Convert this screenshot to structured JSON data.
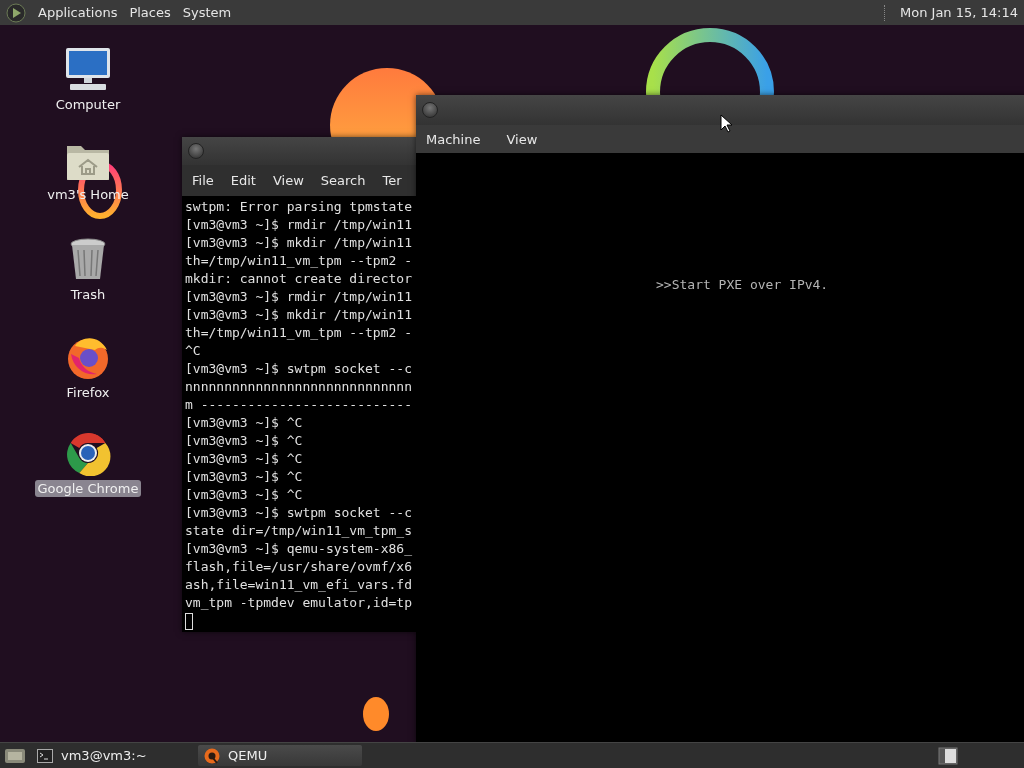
{
  "top_panel": {
    "menus": [
      "Applications",
      "Places",
      "System"
    ],
    "clock": "Mon Jan 15, 14:14"
  },
  "desktop_icons": [
    {
      "label": "Computer",
      "kind": "computer",
      "selected": false
    },
    {
      "label": "vm3's Home",
      "kind": "home",
      "selected": false
    },
    {
      "label": "Trash",
      "kind": "trash",
      "selected": false
    },
    {
      "label": "Firefox",
      "kind": "firefox",
      "selected": false
    },
    {
      "label": "Google Chrome",
      "kind": "chrome",
      "selected": true
    }
  ],
  "terminal": {
    "menus": [
      "File",
      "Edit",
      "View",
      "Search",
      "Ter"
    ],
    "lines": [
      "swtpm: Error parsing tpmstate",
      "[vm3@vm3 ~]$ rmdir /tmp/win11",
      "[vm3@vm3 ~]$ mkdir /tmp/win11",
      "th=/tmp/win11_vm_tpm --tpm2 -",
      "mkdir: cannot create director",
      "[vm3@vm3 ~]$ rmdir /tmp/win11",
      "[vm3@vm3 ~]$ mkdir /tmp/win11",
      "th=/tmp/win11_vm_tpm --tpm2 -",
      "^C",
      "[vm3@vm3 ~]$ swtpm socket --c",
      "nnnnnnnnnnnnnnnnnnnnnnnnnnnnn",
      "m ---------------------------",
      "[vm3@vm3 ~]$ ^C",
      "[vm3@vm3 ~]$ ^C",
      "[vm3@vm3 ~]$ ^C",
      "[vm3@vm3 ~]$ ^C",
      "[vm3@vm3 ~]$ ^C",
      "[vm3@vm3 ~]$ swtpm socket --c",
      "state dir=/tmp/win11_vm_tpm_s",
      "[vm3@vm3 ~]$ qemu-system-x86_",
      "flash,file=/usr/share/ovmf/x6",
      "ash,file=win11_vm_efi_vars.fd",
      "vm_tpm -tpmdev emulator,id=tp"
    ]
  },
  "qemu": {
    "menus": [
      "Machine",
      "View"
    ],
    "screen_text": ">>Start PXE over IPv4."
  },
  "taskbar": {
    "tasks": [
      {
        "label": "vm3@vm3:~",
        "kind": "terminal",
        "selected": false
      },
      {
        "label": "QEMU",
        "kind": "qemu",
        "selected": true
      }
    ]
  }
}
